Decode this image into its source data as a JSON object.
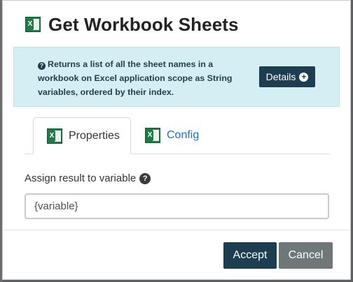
{
  "dialog": {
    "title": "Get Workbook Sheets",
    "title_icon": "excel-icon"
  },
  "info": {
    "text": "Returns a list of all the sheet names in a workbook on Excel application scope as String variables, ordered by their index.",
    "icon": "question-circle-icon",
    "details_label": "Details",
    "details_icon": "plus-circle-icon"
  },
  "tabs": [
    {
      "label": "Properties",
      "icon": "excel-icon",
      "active": true
    },
    {
      "label": "Config",
      "icon": "excel-icon",
      "active": false
    }
  ],
  "field": {
    "label": "Assign result to variable",
    "help_icon": "question-circle-icon",
    "placeholder": "{variable}",
    "value": ""
  },
  "footer": {
    "accept_label": "Accept",
    "cancel_label": "Cancel"
  },
  "colors": {
    "primary": "#1d3e51",
    "secondary": "#707779",
    "info_bg": "#d4eef3",
    "link": "#1d6fd6",
    "excel_green": "#1f7a45"
  }
}
